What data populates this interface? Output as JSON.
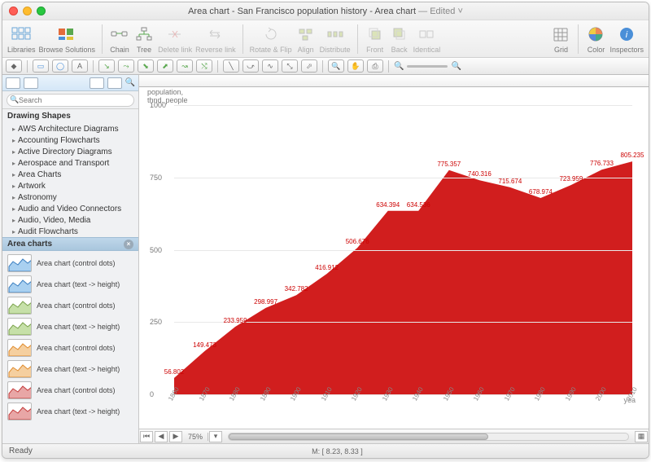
{
  "titlebar": {
    "title": "Area chart - San Francisco population history - Area chart",
    "edited": " — Edited ˅"
  },
  "toolbar": {
    "libraries": "Libraries",
    "browse": "Browse Solutions",
    "chain": "Chain",
    "tree": "Tree",
    "delete_link": "Delete link",
    "reverse_link": "Reverse link",
    "rotate": "Rotate & Flip",
    "align": "Align",
    "distribute": "Distribute",
    "front": "Front",
    "back": "Back",
    "identical": "Identical",
    "grid": "Grid",
    "color": "Color",
    "inspectors": "Inspectors"
  },
  "sidebar": {
    "search_placeholder": "Search",
    "header": "Drawing Shapes",
    "categories": [
      "AWS Architecture Diagrams",
      "Accounting Flowcharts",
      "Active Directory Diagrams",
      "Aerospace and Transport",
      "Area Charts",
      "Artwork",
      "Astronomy",
      "Audio and Video Connectors",
      "Audio, Video, Media",
      "Audit Flowcharts"
    ],
    "selected": "Area charts",
    "shapes": [
      {
        "label": "Area chart (control dots)",
        "stroke": "#3a7ec0",
        "fill": "#a9d0f0"
      },
      {
        "label": "Area chart (text -> height)",
        "stroke": "#3a7ec0",
        "fill": "#a9d0f0"
      },
      {
        "label": "Area chart (control dots)",
        "stroke": "#7aa24a",
        "fill": "#c6e0a8"
      },
      {
        "label": "Area chart (text -> height)",
        "stroke": "#7aa24a",
        "fill": "#c6e0a8"
      },
      {
        "label": "Area chart (control dots)",
        "stroke": "#e08b2c",
        "fill": "#f5cf9f"
      },
      {
        "label": "Area chart (text -> height)",
        "stroke": "#e08b2c",
        "fill": "#f5cf9f"
      },
      {
        "label": "Area chart (control dots)",
        "stroke": "#c43a3a",
        "fill": "#e8a6a6"
      },
      {
        "label": "Area chart (text -> height)",
        "stroke": "#c43a3a",
        "fill": "#e8a6a6"
      }
    ]
  },
  "chart_data": {
    "type": "area",
    "title": "",
    "xlabel": "yea",
    "ylabel": "population,\nthnd. people",
    "ylim": [
      0,
      1000
    ],
    "yticks": [
      0,
      250,
      500,
      750,
      1000
    ],
    "x": [
      1860,
      1870,
      1880,
      1890,
      1900,
      1910,
      1920,
      1930,
      1940,
      1950,
      1960,
      1970,
      1980,
      1990,
      2000,
      2010
    ],
    "values": [
      56.802,
      149.473,
      233.959,
      298.997,
      342.782,
      416.912,
      506.676,
      634.394,
      634.536,
      775.357,
      740.316,
      715.674,
      678.974,
      723.959,
      776.733,
      805.235
    ],
    "fill": "#d11e1e",
    "label_color": "#cc0000"
  },
  "footer": {
    "zoom": "75%",
    "coords": "M: [ 8.23, 8.33 ]"
  },
  "status": {
    "ready": "Ready"
  }
}
